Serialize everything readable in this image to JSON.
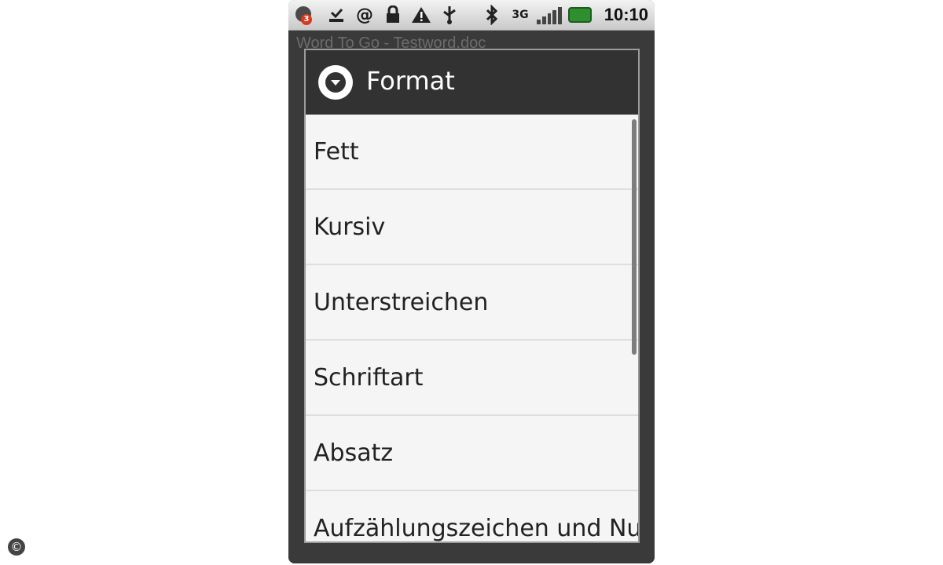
{
  "status_bar": {
    "time": "10:10",
    "notification_count": "3",
    "network": "3G",
    "icons": [
      "notification-icon",
      "download-done-icon",
      "at-sign-icon",
      "lock-icon",
      "warning-icon",
      "usb-icon",
      "bluetooth-icon",
      "3g-icon",
      "signal-icon",
      "battery-icon"
    ]
  },
  "background_app": {
    "title": "Word To Go - Testword.doc"
  },
  "dialog": {
    "title": "Format",
    "header_icon": "chevron-down-circle-icon",
    "items": [
      {
        "label": "Fett"
      },
      {
        "label": "Kursiv"
      },
      {
        "label": "Unterstreichen"
      },
      {
        "label": "Schriftart"
      },
      {
        "label": "Absatz"
      },
      {
        "label": "Aufzählungszeichen und Nu"
      }
    ]
  },
  "footer": {
    "copyright_symbol": "©"
  },
  "colors": {
    "header_bg": "#333232",
    "list_bg": "#f5f5f5",
    "battery": "#2f8f2f"
  }
}
